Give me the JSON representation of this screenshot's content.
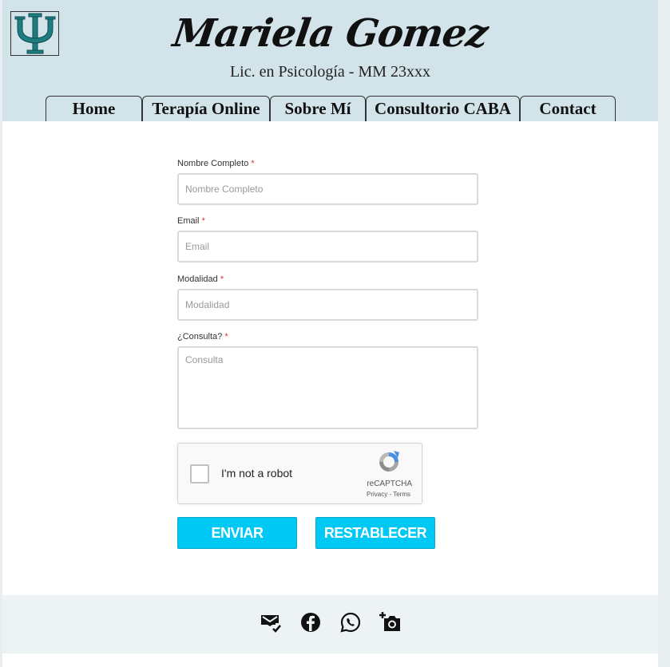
{
  "header": {
    "brand": "Mariela Gomez",
    "subtitle": "Lic. en Psicología - MM 23xxx"
  },
  "nav": {
    "items": [
      {
        "label": "Home"
      },
      {
        "label": "Terapía Online"
      },
      {
        "label": "Sobre Mí"
      },
      {
        "label": "Consultorio CABA"
      },
      {
        "label": "Contact"
      }
    ]
  },
  "form": {
    "fields": [
      {
        "label": "Nombre Completo",
        "required": "*",
        "placeholder": "Nombre Completo",
        "value": ""
      },
      {
        "label": "Email",
        "required": "*",
        "placeholder": "Email",
        "value": ""
      },
      {
        "label": "Modalidad",
        "required": "*",
        "placeholder": "Modalidad",
        "value": ""
      },
      {
        "label": "¿Consulta?",
        "required": "*",
        "placeholder": "Consulta",
        "value": ""
      }
    ],
    "captcha": {
      "label": "I'm not a robot",
      "brand": "reCAPTCHA",
      "links": "Privacy - Terms"
    },
    "submit_label": "ENVIAR",
    "reset_label": "RESTABLECER"
  },
  "footer": {
    "icons": [
      "mail-check-icon",
      "facebook-icon",
      "whatsapp-icon",
      "add-photo-icon"
    ]
  },
  "colors": {
    "header_bg": "#d2e4ea",
    "button_bg": "#00c8f5",
    "footer_bg": "#edf2f5",
    "logo_accent": "#1e7d80"
  }
}
